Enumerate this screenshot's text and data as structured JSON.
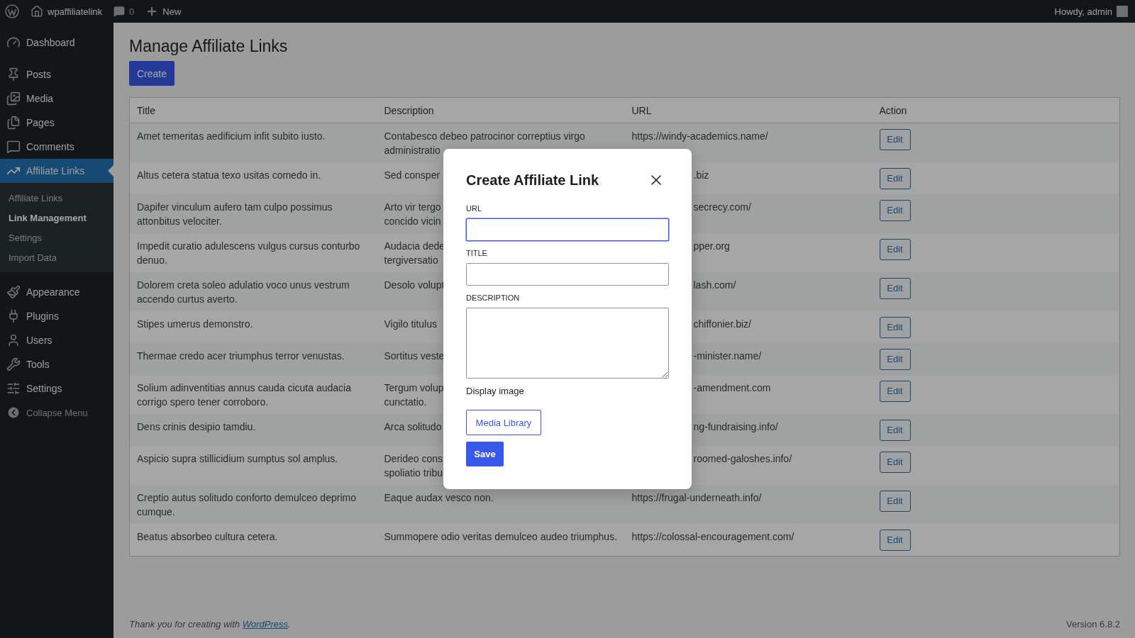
{
  "admin_bar": {
    "site_name": "wpaffiliatelink",
    "comments_count": "0",
    "new_label": "New",
    "greeting": "Howdy, admin"
  },
  "sidebar": {
    "groups": [
      [
        {
          "label": "Dashboard",
          "selected": false
        }
      ],
      [
        {
          "label": "Posts",
          "selected": false
        },
        {
          "label": "Media",
          "selected": false
        },
        {
          "label": "Pages",
          "selected": false
        },
        {
          "label": "Comments",
          "selected": false
        },
        {
          "label": "Affiliate Links",
          "selected": true,
          "children": [
            {
              "label": "Affiliate Links",
              "selected": false
            },
            {
              "label": "Link Management",
              "selected": true
            },
            {
              "label": "Settings",
              "selected": false
            },
            {
              "label": "Import Data",
              "selected": false
            }
          ]
        }
      ],
      [
        {
          "label": "Appearance",
          "selected": false
        },
        {
          "label": "Plugins",
          "selected": false
        },
        {
          "label": "Users",
          "selected": false
        },
        {
          "label": "Tools",
          "selected": false
        },
        {
          "label": "Settings",
          "selected": false
        }
      ]
    ],
    "collapse_label": "Collapse Menu"
  },
  "page": {
    "heading": "Manage Affiliate Links",
    "create_label": "Create",
    "table": {
      "columns": [
        "Title",
        "Description",
        "URL",
        "Action"
      ],
      "rows": [
        {
          "title": "Amet temeritas aedificium infit subito iusto.",
          "description_lines": [
            "Contabesco debeo patrocinor correptius virgo",
            "administratio"
          ],
          "url": "https://windy-academics.name/",
          "covered": false,
          "action": "Edit"
        },
        {
          "title": "Altus cetera statua texo usitas comedo in.",
          "description_lines": [
            "Sed consper"
          ],
          "url": ".biz",
          "covered": true,
          "action": "Edit"
        },
        {
          "title": "Dapifer vinculum aufero tam culpo possimus attonbitus velociter.",
          "description_lines": [
            "Arto vir tergo",
            "concido vicin"
          ],
          "url": "secrecy.com/",
          "covered": true,
          "action": "Edit"
        },
        {
          "title": "Impedit curatio adulescens vulgus cursus conturbo denuo.",
          "description_lines": [
            "Audacia dede",
            "tergiversatio"
          ],
          "url": "pper.org",
          "covered": true,
          "action": "Edit"
        },
        {
          "title": "Dolorem creta soleo adulatio voco unus vestrum accendo curtus averto.",
          "description_lines": [
            "Desolo volupt"
          ],
          "url": "lash.com/",
          "covered": true,
          "action": "Edit"
        },
        {
          "title": "Stipes umerus demonstro.",
          "description_lines": [
            "Vigilo titulus"
          ],
          "url": "chiffonier.biz/",
          "covered": true,
          "action": "Edit"
        },
        {
          "title": "Thermae credo acer triumphus terror venustas.",
          "description_lines": [
            "Sortitus veste"
          ],
          "url": "-minister.name/",
          "covered": true,
          "action": "Edit"
        },
        {
          "title": "Solium adinventitias annus cauda cicuta audacia corrigo spero tener corroboro.",
          "description_lines": [
            "Tergum volup",
            "cunctatio."
          ],
          "url": "-amendment.com",
          "covered": true,
          "action": "Edit"
        },
        {
          "title": "Dens crinis desipio tamdiu.",
          "description_lines": [
            "Arca solitudo"
          ],
          "url": "ng-fundraising.info/",
          "covered": true,
          "action": "Edit"
        },
        {
          "title": "Aspicio supra stillicidium sumptus sol amplus.",
          "description_lines": [
            "Derideo cons",
            "spoliatio tribu"
          ],
          "url": "roomed-galoshes.info/",
          "covered": true,
          "action": "Edit"
        },
        {
          "title": "Creptio autus solitudo conforto demulceo deprimo cumque.",
          "description_lines": [
            "Eaque audax vesco non."
          ],
          "url": "https://frugal-underneath.info/",
          "covered": false,
          "action": "Edit"
        },
        {
          "title": "Beatus absorbeo cultura cetera.",
          "description_lines": [
            "Summopere odio veritas demulceo audeo triumphus."
          ],
          "url": "https://colossal-encouragement.com/",
          "covered": false,
          "action": "Edit"
        }
      ]
    }
  },
  "modal": {
    "title": "Create Affiliate Link",
    "fields": [
      {
        "label": "URL",
        "kind": "input",
        "focused": true
      },
      {
        "label": "TITLE",
        "kind": "input",
        "focused": false
      },
      {
        "label": "DESCRIPTION",
        "kind": "textarea",
        "focused": false
      }
    ],
    "image_label": "Display image",
    "media_button": "Media Library",
    "save_button": "Save"
  },
  "footer": {
    "text_before": "Thank you for creating with ",
    "link": "WordPress",
    "text_after": ".",
    "version": "Version 6.8.2"
  }
}
